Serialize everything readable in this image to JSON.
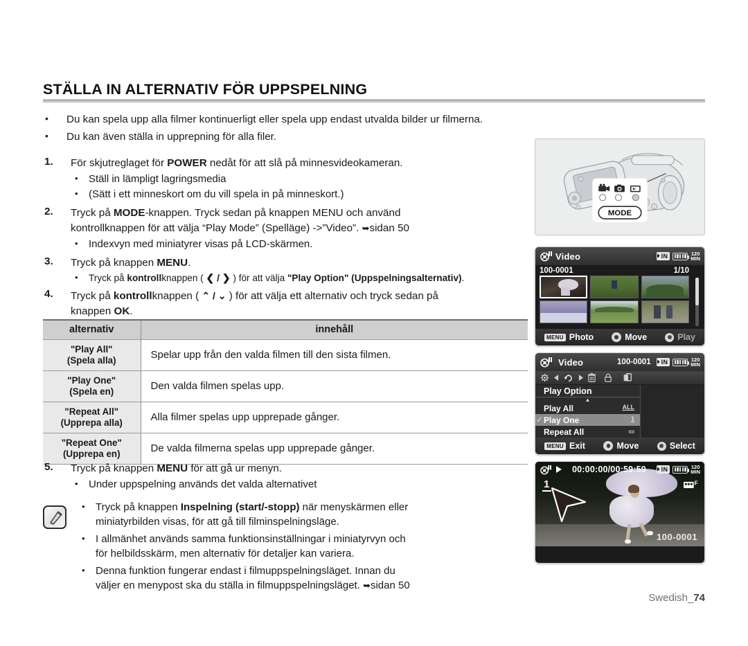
{
  "heading": "STÄLLA IN ALTERNATIV FÖR UPPSPELNING",
  "intro": [
    "Du kan spela upp alla filmer kontinuerligt eller spela upp endast utvalda bilder ur filmerna.",
    "Du kan även ställa in upprepning för alla filer."
  ],
  "steps": {
    "s1_num": "1.",
    "s1_a": "För skjutreglaget för ",
    "s1_b": "POWER",
    "s1_c": " nedåt för att slå på minnesvideokameran.",
    "s1_sub1": "Ställ in lämpligt lagringsmedia",
    "s1_sub2": "(Sätt i ett minneskort om du vill spela in på minneskort.)",
    "s2_num": "2.",
    "s2_a": "Tryck på ",
    "s2_b": "MODE",
    "s2_c": "-knappen. Tryck sedan på knappen MENU och använd",
    "s2_line2": "kontrollknappen för att välja “Play Mode” (Spelläge) ->”Video”.",
    "s2_page": "sidan 50",
    "s2_sub1": "Indexvyn med miniatyrer visas på LCD-skärmen.",
    "s3_num": "3.",
    "s3_a": "Tryck på knappen ",
    "s3_b": "MENU",
    "s3_c": ".",
    "s3_sub_a": "Tryck på ",
    "s3_sub_b": "kontroll",
    "s3_sub_c": "knappen ( ",
    "s3_sub_arrows": "❮ / ❯",
    "s3_sub_d": " ) för att välja ",
    "s3_sub_e": "\"Play Option\" (Uppspelningsalternativ)",
    "s3_sub_f": ".",
    "s4_num": "4.",
    "s4_a": "Tryck på ",
    "s4_b": "kontroll",
    "s4_c": "knappen ( ",
    "s4_arrows": "⌃ / ⌄",
    "s4_d": " ) för att välja ett alternativ och tryck sedan på",
    "s4_line2_a": "knappen ",
    "s4_line2_b": "OK",
    "s4_line2_c": ".",
    "s5_num": "5.",
    "s5_a": "Tryck på knappen ",
    "s5_b": "MENU",
    "s5_c": " för att gå ur menyn.",
    "s5_sub1": "Under uppspelning används det valda alternativet"
  },
  "table": {
    "headers": [
      "alternativ",
      "innehåll"
    ],
    "rows": [
      {
        "option_en": "\"Play All\"",
        "option_sv": "(Spela alla)",
        "content": "Spelar upp från den valda filmen till den sista filmen."
      },
      {
        "option_en": "\"Play One\"",
        "option_sv": "(Spela en)",
        "content": "Den valda filmen spelas upp."
      },
      {
        "option_en": "\"Repeat All\"",
        "option_sv": "(Upprepa alla)",
        "content": "Alla filmer spelas upp upprepade gånger."
      },
      {
        "option_en": "\"Repeat One\"",
        "option_sv": "(Upprepa en)",
        "content": "De valda filmerna spelas upp upprepade gånger."
      }
    ]
  },
  "notes": {
    "icon": "note-pencil-icon",
    "n1_a": "Tryck på knappen ",
    "n1_b": "Inspelning (start/-stopp)",
    "n1_c": " när menyskärmen eller",
    "n1_line2": "miniatyrbilden visas, för att gå till filminspelningsläge.",
    "n2_line1": "I allmänhet används samma funktionsinställningar i miniatyrvyn och",
    "n2_line2": "för helbildsskärm, men alternativ för detaljer kan variera.",
    "n3_line1": "Denna funktion fungerar endast i filmuppspelningsläget. Innan du",
    "n3_line2": "väljer en menypost ska du ställa in filmuppspelningsläget.",
    "n3_page": "sidan 50"
  },
  "footer": {
    "language": "Swedish_",
    "page": "74"
  },
  "illustration": {
    "name": "camcorder-mode-button-illustration",
    "mode_label": "MODE",
    "icons": [
      "video-camera-icon",
      "photo-camera-icon",
      "play-mode-icon"
    ]
  },
  "thumb_screen": {
    "title": "Video",
    "file_number": "100-0001",
    "page_indicator": "1/10",
    "status": {
      "storage": "IN",
      "battery": "battery-full-icon",
      "time_value": "120",
      "time_unit": "MIN"
    },
    "bottom": {
      "menu_key": "MENU",
      "menu_label": "Photo",
      "move_label": "Move",
      "play_label": "Play"
    },
    "thumbnails": [
      {
        "name": "thumb-girl-umbrella",
        "selected": true
      },
      {
        "name": "thumb-soccer-field",
        "selected": false
      },
      {
        "name": "thumb-mountain-trees",
        "selected": false
      },
      {
        "name": "thumb-snow-river",
        "selected": false
      },
      {
        "name": "thumb-green-meadow",
        "selected": false
      },
      {
        "name": "thumb-rollerbladers",
        "selected": false
      }
    ]
  },
  "menu_screen": {
    "title": "Video",
    "file_number": "100-0001",
    "status": {
      "storage": "IN",
      "battery": "battery-full-icon",
      "time_value": "120",
      "time_unit": "MIN"
    },
    "tabs": [
      "settings-gear-icon",
      "arrow-left-icon",
      "play-option-icon",
      "arrow-right-icon",
      "trash-icon",
      "lock-icon",
      "copy-icon"
    ],
    "list_header": "Play Option",
    "items": [
      {
        "label": "Play All",
        "icon": "all-icon",
        "selected": false
      },
      {
        "label": "Play One",
        "icon": "one-icon",
        "selected": true
      },
      {
        "label": "Repeat All",
        "icon": "repeat-all-icon",
        "selected": false
      }
    ],
    "bottom": {
      "menu_key": "MENU",
      "exit_label": "Exit",
      "move_label": "Move",
      "select_label": "Select"
    }
  },
  "play_screen": {
    "timecode": "00:00:00/00:59:59",
    "index": "1",
    "file_number": "100-0001",
    "format_icon": "F",
    "status": {
      "storage": "IN",
      "battery": "battery-full-icon",
      "time_value": "120",
      "time_unit": "MIN"
    },
    "play_icon": "play-triangle-icon",
    "cursor": "pointer-cursor-icon"
  }
}
